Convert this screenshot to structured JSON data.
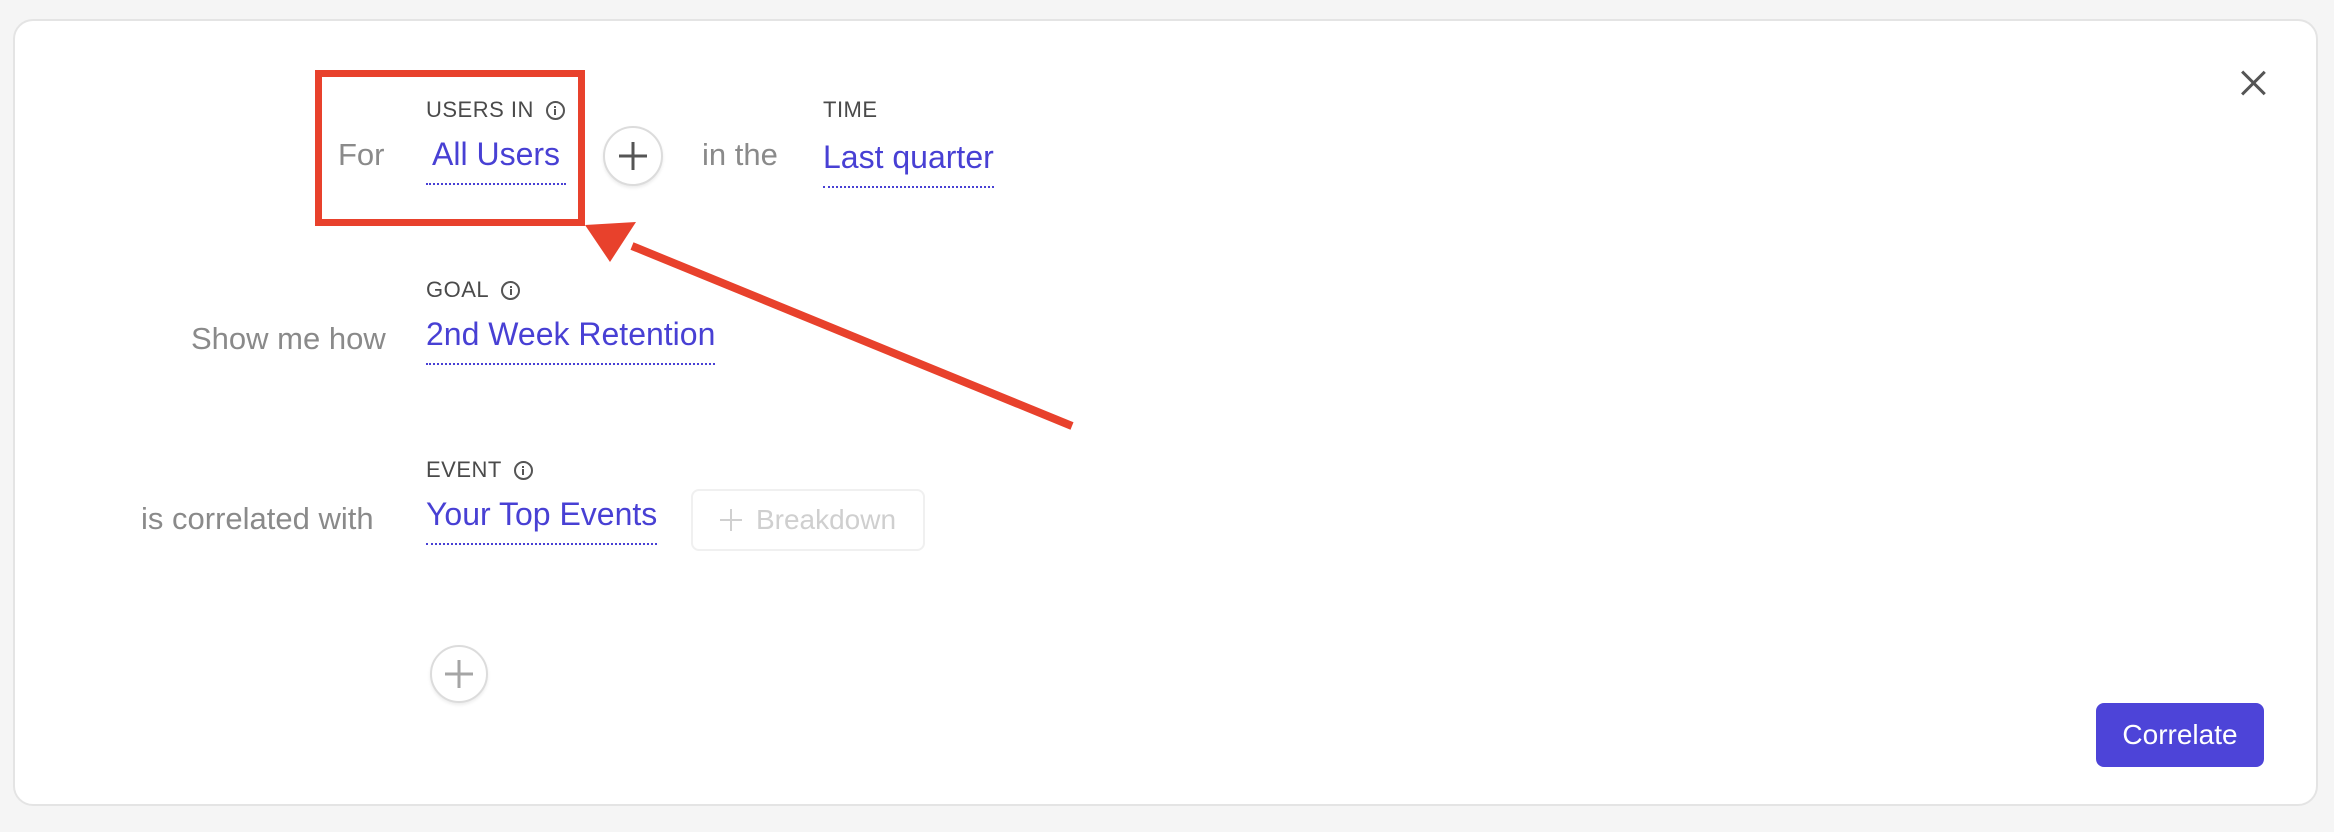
{
  "row1": {
    "prefix": "For",
    "users_caption": "USERS IN",
    "users_value": "All Users",
    "connector": "in the",
    "time_caption": "TIME",
    "time_value": "Last quarter"
  },
  "row2": {
    "prefix": "Show me how",
    "goal_caption": "GOAL",
    "goal_value": "2nd Week Retention"
  },
  "row3": {
    "prefix": "is correlated with",
    "event_caption": "EVENT",
    "event_value": "Your Top Events",
    "breakdown_label": "Breakdown"
  },
  "actions": {
    "correlate_label": "Correlate"
  },
  "colors": {
    "accent": "#4840d4",
    "button": "#4d44d8",
    "annotation": "#e8412c"
  },
  "icons": [
    "info-icon",
    "plus-icon",
    "close-icon"
  ]
}
